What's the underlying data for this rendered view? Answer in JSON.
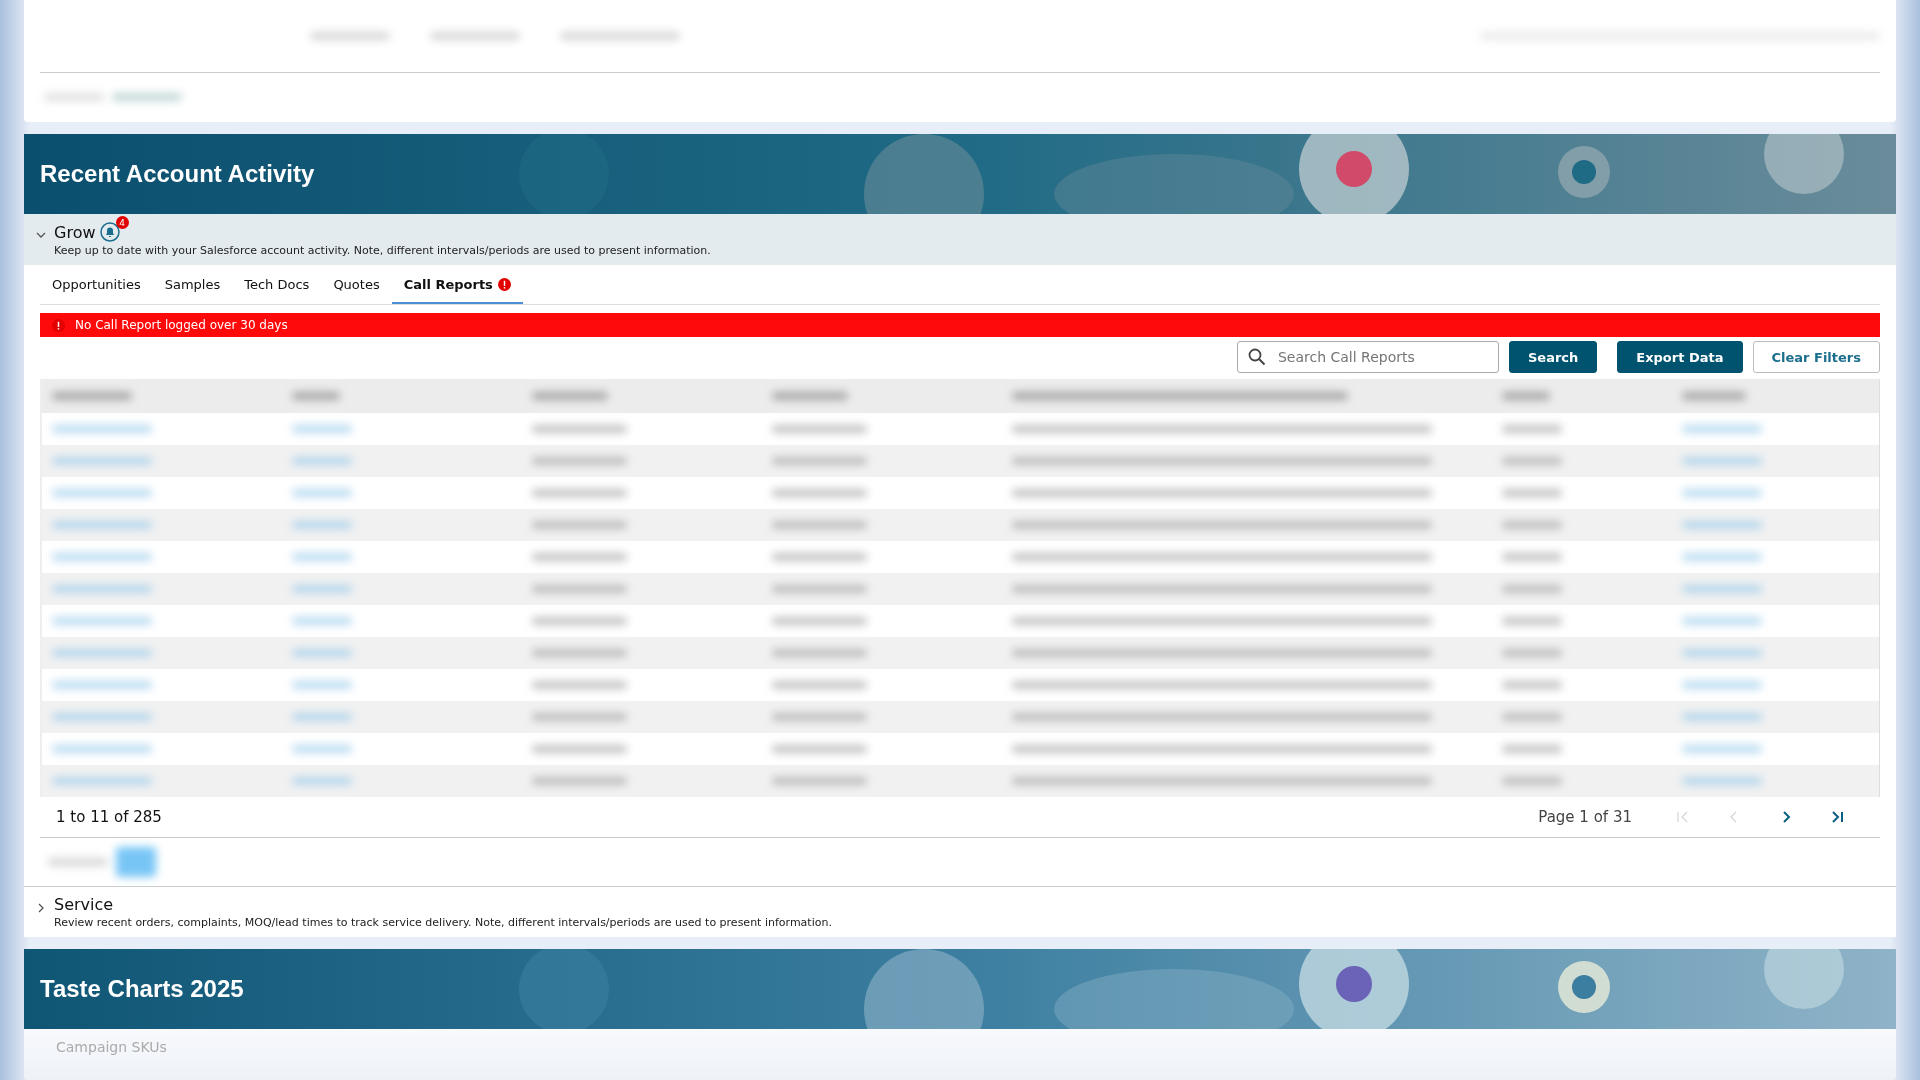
{
  "activity": {
    "title": "Recent Account Activity",
    "sections": [
      {
        "title": "Grow",
        "badge": "4",
        "expanded": true,
        "description": "Keep up to date with your Salesforce account activity. Note, different intervals/periods are used to present information."
      },
      {
        "title": "Service",
        "expanded": false,
        "description": "Review recent orders, complaints, MOQ/lead times to track service delivery. Note, different intervals/periods are used to present information."
      }
    ],
    "tabs": [
      {
        "label": "Opportunities",
        "selected": false,
        "alert": false
      },
      {
        "label": "Samples",
        "selected": false,
        "alert": false
      },
      {
        "label": "Tech Docs",
        "selected": false,
        "alert": false
      },
      {
        "label": "Quotes",
        "selected": false,
        "alert": false
      },
      {
        "label": "Call Reports",
        "selected": true,
        "alert": true
      }
    ],
    "alert_banner": "No Call Report logged over 30 days",
    "search": {
      "placeholder": "Search Call Reports"
    },
    "buttons": [
      {
        "label": "Search",
        "kind": "primary"
      },
      {
        "label": "Export Data",
        "kind": "primary"
      },
      {
        "label": "Clear Filters",
        "kind": "outline"
      }
    ],
    "pagination": {
      "range": "1 to 11 of 285",
      "page": "Page 1 of 31",
      "nav": [
        {
          "kind": "first",
          "disabled": true
        },
        {
          "kind": "prev",
          "disabled": true
        },
        {
          "kind": "next",
          "disabled": false
        },
        {
          "kind": "last",
          "disabled": false
        }
      ]
    }
  },
  "taste_charts": {
    "title": "Taste Charts 2025",
    "subtitle": "Campaign SKUs"
  }
}
